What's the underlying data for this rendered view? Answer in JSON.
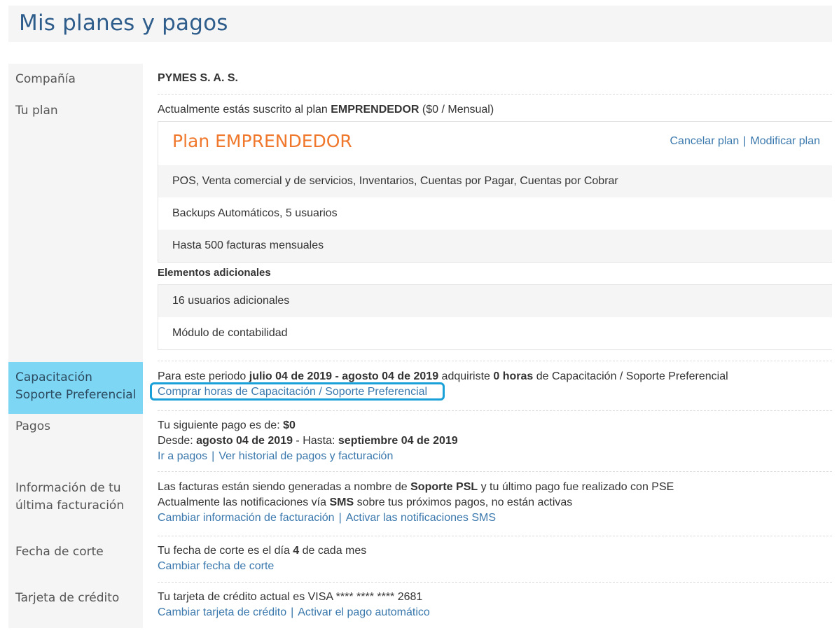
{
  "header": {
    "title": "Mis planes y pagos"
  },
  "sidebar": {
    "company": "Compañía",
    "plan": "Tu plan",
    "training_line1": "Capacitación",
    "training_line2": "Soporte Preferencial",
    "payments": "Pagos",
    "billing_line1": "Información de tu",
    "billing_line2": "última facturación",
    "cutoff": "Fecha de corte",
    "card": "Tarjeta de crédito"
  },
  "company": {
    "name": "PYMES S. A. S."
  },
  "plan": {
    "subscribed_prefix": "Actualmente estás suscrito al plan ",
    "plan_name": "EMPRENDEDOR",
    "price": " ($0 / Mensual)",
    "box_title": "Plan EMPRENDEDOR",
    "cancel_label": "Cancelar plan",
    "separator": "|",
    "modify_label": "Modificar plan",
    "features": [
      "POS, Venta comercial y de servicios, Inventarios, Cuentas por Pagar, Cuentas por Cobrar",
      "Backups Automáticos, 5 usuarios",
      "Hasta 500 facturas mensuales"
    ],
    "additional_title": "Elementos adicionales",
    "additional": [
      "16 usuarios adicionales",
      "Módulo de contabilidad"
    ]
  },
  "training": {
    "prefix": "Para este periodo ",
    "period": "julio 04 de 2019 - agosto 04 de 2019",
    "mid": " adquiriste ",
    "hours": "0 horas",
    "suffix": " de Capacitación / Soporte Preferencial",
    "buy_link": "Comprar horas de Capacitación / Soporte Preferencial"
  },
  "payments": {
    "next_prefix": "Tu siguiente pago es de: ",
    "amount": "$0",
    "from_label": "Desde: ",
    "from_date": "agosto 04 de 2019",
    "to_label": " - Hasta: ",
    "to_date": "septiembre 04 de 2019",
    "go_link": "Ir a pagos",
    "history_link": "Ver historial de pagos y facturación"
  },
  "billing": {
    "line1_prefix": "Las facturas están siendo generadas a nombre de ",
    "line1_name": "Soporte PSL",
    "line1_suffix": " y tu último pago fue realizado con PSE",
    "line2_prefix": "Actualmente las notificaciones vía ",
    "line2_sms": "SMS",
    "line2_suffix": " sobre tus próximos pagos, no están activas",
    "change_link": "Cambiar información de facturación",
    "sms_link": "Activar las notificaciones SMS"
  },
  "cutoff": {
    "prefix": "Tu fecha de corte es el día ",
    "day": "4",
    "suffix": " de cada mes",
    "change_link": "Cambiar fecha de corte"
  },
  "card": {
    "text": "Tu tarjeta de crédito actual es VISA **** **** **** 2681",
    "change_link": "Cambiar tarjeta de crédito",
    "auto_link": "Activar el pago automático"
  },
  "colors": {
    "title_blue": "#2e5d8c",
    "link_blue": "#3a78ad",
    "plan_orange": "#f0782d",
    "active_sidebar": "#7dd6f3",
    "focus_ring": "#1aa0d8"
  }
}
